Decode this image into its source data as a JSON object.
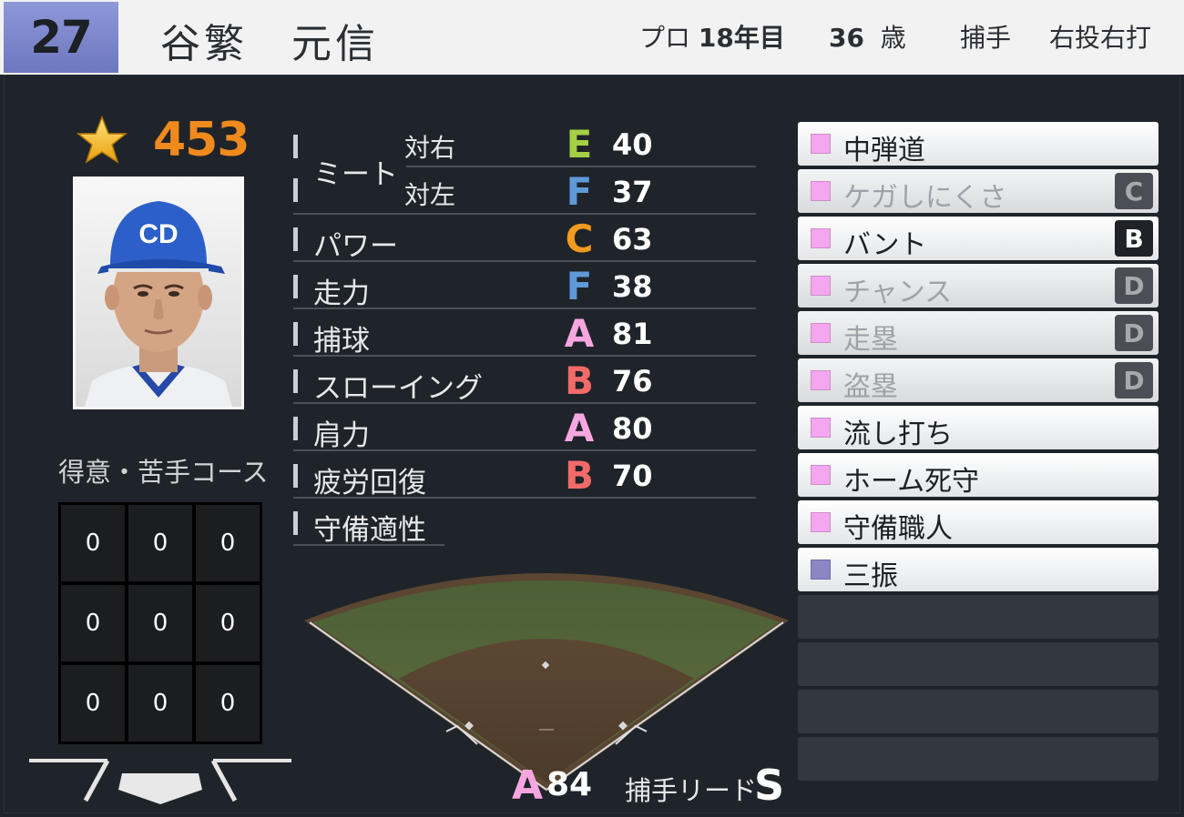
{
  "header": {
    "number": "27",
    "name": "谷繁　元信",
    "pro_label": "プロ",
    "pro_years": "18年目",
    "age_value": "36",
    "age_unit": "歳",
    "position": "捕手",
    "handedness": "右投右打"
  },
  "overview": {
    "rating": "453",
    "course_title": "得意・苦手コース",
    "course_grid": [
      "0",
      "0",
      "0",
      "0",
      "0",
      "0",
      "0",
      "0",
      "0"
    ]
  },
  "stats": {
    "meet_label": "ミート",
    "meet_right_label": "対右",
    "meet_left_label": "対左",
    "rows": [
      {
        "label": "",
        "grade": "E",
        "value": "40",
        "color": "#a5cf44"
      },
      {
        "label": "",
        "grade": "F",
        "value": "37",
        "color": "#5f9ad8"
      },
      {
        "label": "パワー",
        "grade": "C",
        "value": "63",
        "color": "#f49a1e"
      },
      {
        "label": "走力",
        "grade": "F",
        "value": "38",
        "color": "#5f9ad8"
      },
      {
        "label": "捕球",
        "grade": "A",
        "value": "81",
        "color": "#f7a6e0"
      },
      {
        "label": "スローイング",
        "grade": "B",
        "value": "76",
        "color": "#f36a6a"
      },
      {
        "label": "肩力",
        "grade": "A",
        "value": "80",
        "color": "#f7a6e0"
      },
      {
        "label": "疲労回復",
        "grade": "B",
        "value": "70",
        "color": "#f36a6a"
      },
      {
        "label": "守備適性",
        "grade": "",
        "value": "",
        "color": "#ffffff"
      }
    ]
  },
  "defense": {
    "lead_grade": "A",
    "lead_value": "84",
    "lead_label": "捕手リード",
    "lead_rank": "S"
  },
  "abilities": [
    {
      "name": "中弾道",
      "level": ""
    },
    {
      "name": "ケガしにくさ",
      "level": "C"
    },
    {
      "name": "バント",
      "level": "B"
    },
    {
      "name": "チャンス",
      "level": "D"
    },
    {
      "name": "走塁",
      "level": "D"
    },
    {
      "name": "盗塁",
      "level": "D"
    },
    {
      "name": "流し打ち",
      "level": ""
    },
    {
      "name": "ホーム死守",
      "level": ""
    },
    {
      "name": "守備職人",
      "level": ""
    },
    {
      "name": "三振",
      "level": ""
    }
  ]
}
